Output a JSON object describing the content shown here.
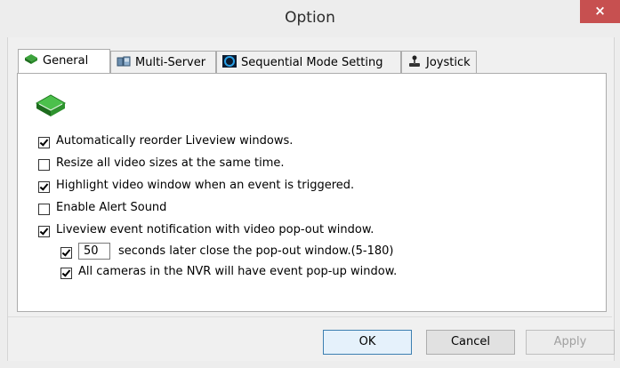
{
  "window": {
    "title": "Option",
    "close_label": "×"
  },
  "tabs": [
    {
      "label": "General",
      "icon": "book-icon",
      "active": true
    },
    {
      "label": "Multi-Server",
      "icon": "server-icon",
      "active": false
    },
    {
      "label": "Sequential Mode Setting",
      "icon": "sequence-icon",
      "active": false
    },
    {
      "label": "Joystick",
      "icon": "joystick-icon",
      "active": false
    }
  ],
  "general": {
    "header_icon": "book-icon",
    "options": [
      {
        "label": "Automatically reorder Liveview windows.",
        "checked": true
      },
      {
        "label": "Resize all video sizes at the same time.",
        "checked": false
      },
      {
        "label": "Highlight video window when an event is triggered.",
        "checked": true
      },
      {
        "label": "Enable Alert Sound",
        "checked": false
      },
      {
        "label": "Liveview event notification with video pop-out window.",
        "checked": true
      }
    ],
    "popout_close": {
      "checked": true,
      "value": "50",
      "label": "seconds later close the pop-out window.(5-180)"
    },
    "all_cameras": {
      "checked": true,
      "label": "All cameras in the NVR will have event pop-up window."
    }
  },
  "buttons": {
    "ok": "OK",
    "cancel": "Cancel",
    "apply": "Apply"
  }
}
